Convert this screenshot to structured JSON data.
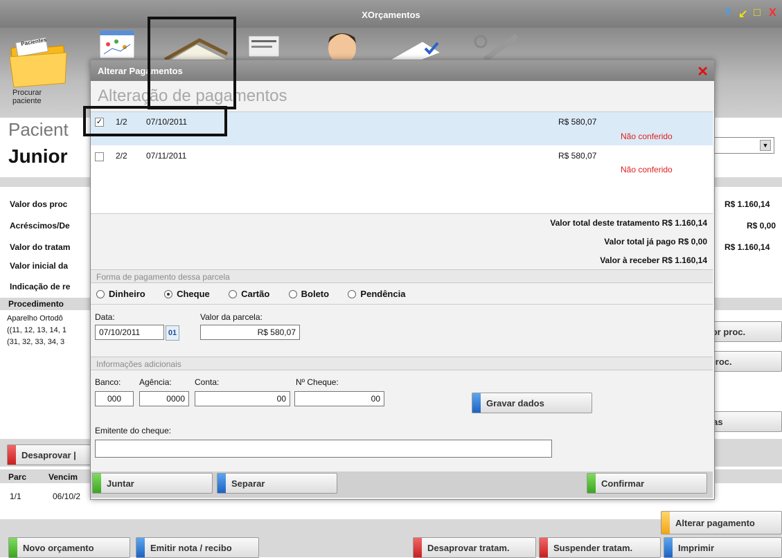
{
  "app": {
    "title": "XOrçamentos",
    "window_controls": [
      "?",
      "↙",
      "□",
      "X"
    ]
  },
  "toolbar": {
    "search_patient_label": "Procurar\npaciente",
    "patient_folder_tab": "Pacientes"
  },
  "background": {
    "patient_label": "Pacient",
    "patient_name": "Junior",
    "summary_left": [
      "Valor dos proc",
      "Acréscimos/De",
      "Valor do tratam",
      "Valor inicial da",
      "Indicação de re"
    ],
    "summary_right": [
      "R$ 1.160,14",
      "R$ 0,00",
      "R$ 1.160,14"
    ],
    "procedures_header": "Procedimento",
    "procedure_lines": [
      "Aparelho Ortodô",
      "((11, 12, 13, 14, 1",
      "(31, 32, 33, 34, 3"
    ],
    "side_buttons": [
      "r valor proc.",
      "nar proc.",
      "r datas"
    ],
    "disapprove_short": "Desaprovar |",
    "installments_header": [
      "Parc",
      "Vencim"
    ],
    "installment_row": [
      "1/1",
      "06/10/2"
    ],
    "alter_payment_button": "Alterar pagamento",
    "bottom_buttons": [
      {
        "label": "Novo orçamento",
        "color": "green"
      },
      {
        "label": "Emitir nota / recibo",
        "color": "blue"
      },
      {
        "label": "Desaprovar tratam.",
        "color": "red"
      },
      {
        "label": "Suspender tratam.",
        "color": "red"
      },
      {
        "label": "Imprimir",
        "color": "blue"
      }
    ]
  },
  "dialog": {
    "title": "Alterar Pagamentos",
    "heading": "Alteração de pagamentos",
    "installments": [
      {
        "number": "1/2",
        "date": "07/10/2011",
        "amount": "R$ 580,07",
        "status": "Não conferido",
        "checked": true
      },
      {
        "number": "2/2",
        "date": "07/11/2011",
        "amount": "R$ 580,07",
        "status": "Não conferido",
        "checked": false
      }
    ],
    "totals": {
      "treatment_total": "Valor total deste tratamento R$ 1.160,14",
      "paid_total": "Valor total já pago R$ 0,00",
      "to_receive": "Valor à receber R$ 1.160,14"
    },
    "payment_section_label": "Forma de pagamento dessa parcela",
    "payment_methods": [
      {
        "label": "Dinheiro",
        "selected": false
      },
      {
        "label": "Cheque",
        "selected": true
      },
      {
        "label": "Cartão",
        "selected": false
      },
      {
        "label": "Boleto",
        "selected": false
      },
      {
        "label": "Pendência",
        "selected": false
      }
    ],
    "date_label": "Data:",
    "date_value": "07/10/2011",
    "calendar_button": "01",
    "installment_value_label": "Valor da parcela:",
    "installment_value": "R$ 580,07",
    "additional_section_label": "Informações adicionais",
    "bank_label": "Banco:",
    "bank_value": "000",
    "agency_label": "Agência:",
    "agency_value": "0000",
    "account_label": "Conta:",
    "account_value": "00",
    "check_number_label": "Nº Cheque:",
    "check_number_value": "00",
    "save_button": "Gravar dados",
    "issuer_label": "Emitente do cheque:",
    "issuer_value": "",
    "join_button": "Juntar",
    "split_button": "Separar",
    "confirm_button": "Confirmar"
  },
  "colors": {
    "selected_row": "#dbeaf7",
    "status_red": "#e21e1e",
    "close_red": "#e01010"
  }
}
